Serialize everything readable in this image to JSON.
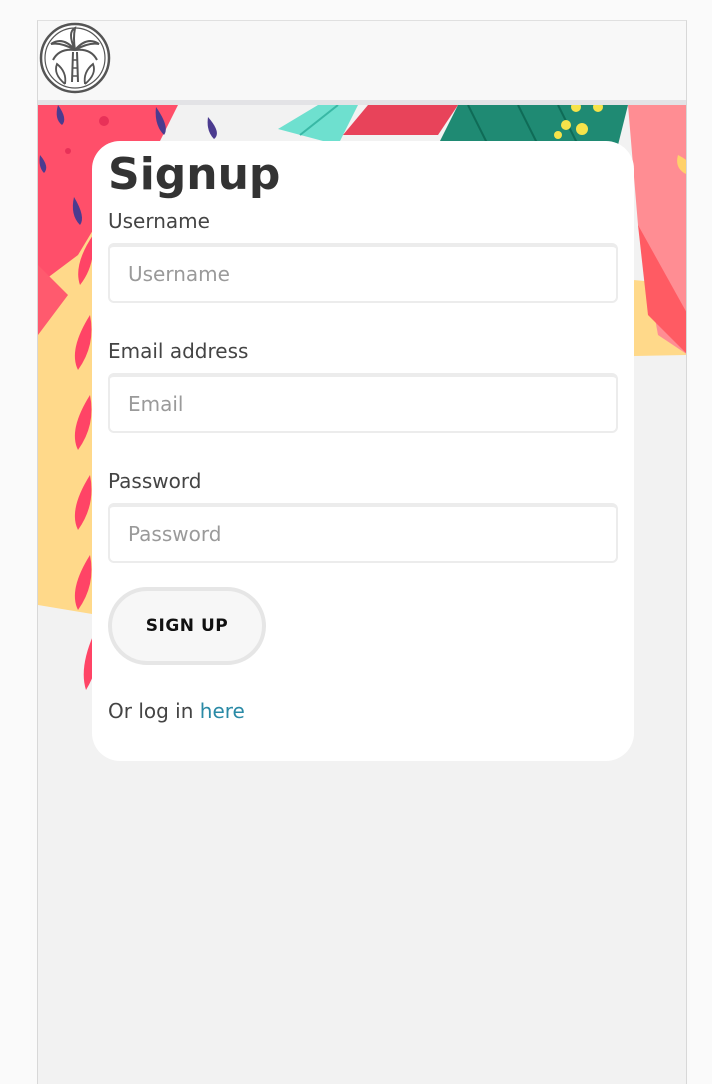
{
  "form": {
    "title": "Signup",
    "username": {
      "label": "Username",
      "placeholder": "Username"
    },
    "email": {
      "label": "Email address",
      "placeholder": "Email"
    },
    "password": {
      "label": "Password",
      "placeholder": "Password"
    },
    "submit_label": "SIGN UP",
    "login_prefix": "Or log in ",
    "login_link": "here"
  },
  "theme": {
    "link_color": "#2a8aa6",
    "background": "#f2f2f2"
  },
  "icons": {
    "logo": "palm-tree-icon"
  }
}
